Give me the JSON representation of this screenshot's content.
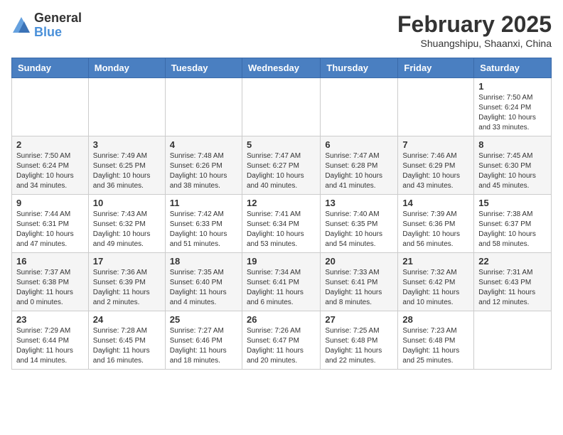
{
  "logo": {
    "general": "General",
    "blue": "Blue"
  },
  "title": "February 2025",
  "location": "Shuangshipu, Shaanxi, China",
  "weekdays": [
    "Sunday",
    "Monday",
    "Tuesday",
    "Wednesday",
    "Thursday",
    "Friday",
    "Saturday"
  ],
  "weeks": [
    [
      null,
      null,
      null,
      null,
      null,
      null,
      {
        "day": "1",
        "sunrise": "7:50 AM",
        "sunset": "6:24 PM",
        "daylight": "10 hours and 33 minutes."
      }
    ],
    [
      {
        "day": "2",
        "sunrise": "7:50 AM",
        "sunset": "6:24 PM",
        "daylight": "10 hours and 34 minutes."
      },
      {
        "day": "3",
        "sunrise": "7:49 AM",
        "sunset": "6:25 PM",
        "daylight": "10 hours and 36 minutes."
      },
      {
        "day": "4",
        "sunrise": "7:48 AM",
        "sunset": "6:26 PM",
        "daylight": "10 hours and 38 minutes."
      },
      {
        "day": "5",
        "sunrise": "7:47 AM",
        "sunset": "6:27 PM",
        "daylight": "10 hours and 40 minutes."
      },
      {
        "day": "6",
        "sunrise": "7:47 AM",
        "sunset": "6:28 PM",
        "daylight": "10 hours and 41 minutes."
      },
      {
        "day": "7",
        "sunrise": "7:46 AM",
        "sunset": "6:29 PM",
        "daylight": "10 hours and 43 minutes."
      },
      {
        "day": "8",
        "sunrise": "7:45 AM",
        "sunset": "6:30 PM",
        "daylight": "10 hours and 45 minutes."
      }
    ],
    [
      {
        "day": "9",
        "sunrise": "7:44 AM",
        "sunset": "6:31 PM",
        "daylight": "10 hours and 47 minutes."
      },
      {
        "day": "10",
        "sunrise": "7:43 AM",
        "sunset": "6:32 PM",
        "daylight": "10 hours and 49 minutes."
      },
      {
        "day": "11",
        "sunrise": "7:42 AM",
        "sunset": "6:33 PM",
        "daylight": "10 hours and 51 minutes."
      },
      {
        "day": "12",
        "sunrise": "7:41 AM",
        "sunset": "6:34 PM",
        "daylight": "10 hours and 53 minutes."
      },
      {
        "day": "13",
        "sunrise": "7:40 AM",
        "sunset": "6:35 PM",
        "daylight": "10 hours and 54 minutes."
      },
      {
        "day": "14",
        "sunrise": "7:39 AM",
        "sunset": "6:36 PM",
        "daylight": "10 hours and 56 minutes."
      },
      {
        "day": "15",
        "sunrise": "7:38 AM",
        "sunset": "6:37 PM",
        "daylight": "10 hours and 58 minutes."
      }
    ],
    [
      {
        "day": "16",
        "sunrise": "7:37 AM",
        "sunset": "6:38 PM",
        "daylight": "11 hours and 0 minutes."
      },
      {
        "day": "17",
        "sunrise": "7:36 AM",
        "sunset": "6:39 PM",
        "daylight": "11 hours and 2 minutes."
      },
      {
        "day": "18",
        "sunrise": "7:35 AM",
        "sunset": "6:40 PM",
        "daylight": "11 hours and 4 minutes."
      },
      {
        "day": "19",
        "sunrise": "7:34 AM",
        "sunset": "6:41 PM",
        "daylight": "11 hours and 6 minutes."
      },
      {
        "day": "20",
        "sunrise": "7:33 AM",
        "sunset": "6:41 PM",
        "daylight": "11 hours and 8 minutes."
      },
      {
        "day": "21",
        "sunrise": "7:32 AM",
        "sunset": "6:42 PM",
        "daylight": "11 hours and 10 minutes."
      },
      {
        "day": "22",
        "sunrise": "7:31 AM",
        "sunset": "6:43 PM",
        "daylight": "11 hours and 12 minutes."
      }
    ],
    [
      {
        "day": "23",
        "sunrise": "7:29 AM",
        "sunset": "6:44 PM",
        "daylight": "11 hours and 14 minutes."
      },
      {
        "day": "24",
        "sunrise": "7:28 AM",
        "sunset": "6:45 PM",
        "daylight": "11 hours and 16 minutes."
      },
      {
        "day": "25",
        "sunrise": "7:27 AM",
        "sunset": "6:46 PM",
        "daylight": "11 hours and 18 minutes."
      },
      {
        "day": "26",
        "sunrise": "7:26 AM",
        "sunset": "6:47 PM",
        "daylight": "11 hours and 20 minutes."
      },
      {
        "day": "27",
        "sunrise": "7:25 AM",
        "sunset": "6:48 PM",
        "daylight": "11 hours and 22 minutes."
      },
      {
        "day": "28",
        "sunrise": "7:23 AM",
        "sunset": "6:48 PM",
        "daylight": "11 hours and 25 minutes."
      },
      null
    ]
  ]
}
